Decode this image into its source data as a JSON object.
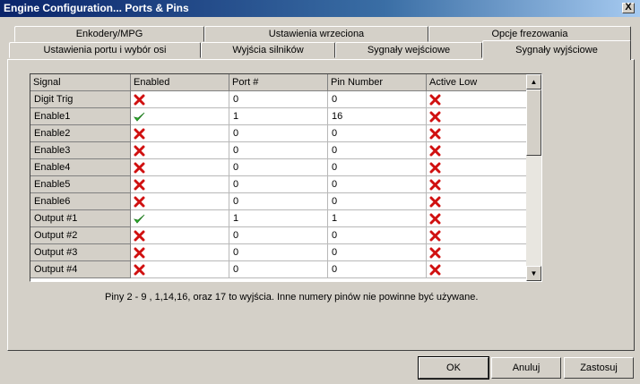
{
  "window": {
    "title": "Engine Configuration... Ports & Pins",
    "close_label": "X"
  },
  "tabs_row1": [
    {
      "label": "Enkodery/MPG"
    },
    {
      "label": "Ustawienia wrzeciona"
    },
    {
      "label": "Opcje frezowania"
    }
  ],
  "tabs_row2": [
    {
      "label": "Ustawienia portu i wybór osi"
    },
    {
      "label": "Wyjścia silników"
    },
    {
      "label": "Sygnały wejściowe"
    },
    {
      "label": "Sygnały wyjściowe"
    }
  ],
  "grid": {
    "columns": [
      "Signal",
      "Enabled",
      "Port #",
      "Pin Number",
      "Active Low"
    ],
    "rows": [
      {
        "signal": "Digit  Trig",
        "enabled": false,
        "port": "0",
        "pin": "0",
        "active_low": false
      },
      {
        "signal": "Enable1",
        "enabled": true,
        "port": "1",
        "pin": "16",
        "active_low": false
      },
      {
        "signal": "Enable2",
        "enabled": false,
        "port": "0",
        "pin": "0",
        "active_low": false
      },
      {
        "signal": "Enable3",
        "enabled": false,
        "port": "0",
        "pin": "0",
        "active_low": false
      },
      {
        "signal": "Enable4",
        "enabled": false,
        "port": "0",
        "pin": "0",
        "active_low": false
      },
      {
        "signal": "Enable5",
        "enabled": false,
        "port": "0",
        "pin": "0",
        "active_low": false
      },
      {
        "signal": "Enable6",
        "enabled": false,
        "port": "0",
        "pin": "0",
        "active_low": false
      },
      {
        "signal": "Output #1",
        "enabled": true,
        "port": "1",
        "pin": "1",
        "active_low": false
      },
      {
        "signal": "Output #2",
        "enabled": false,
        "port": "0",
        "pin": "0",
        "active_low": false
      },
      {
        "signal": "Output #3",
        "enabled": false,
        "port": "0",
        "pin": "0",
        "active_low": false
      },
      {
        "signal": "Output #4",
        "enabled": false,
        "port": "0",
        "pin": "0",
        "active_low": false
      }
    ]
  },
  "note": "Piny 2 - 9 , 1,14,16, oraz 17 to wyjścia. Inne numery pinów nie powinne być używane.",
  "buttons": {
    "ok": "OK",
    "cancel": "Anuluj",
    "apply": "Zastosuj"
  },
  "icons": {
    "checked": "green-check-icon",
    "unchecked": "red-x-icon"
  },
  "colors": {
    "check": "#2db52d",
    "cross": "#d01010",
    "titlebar": "#0a246a"
  }
}
